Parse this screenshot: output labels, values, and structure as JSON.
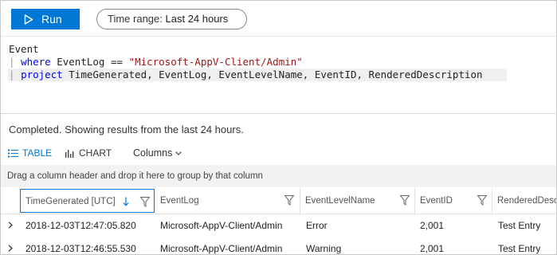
{
  "toolbar": {
    "run_label": "Run",
    "time_range_key": "Time range:",
    "time_range_value": "Last 24 hours"
  },
  "editor": {
    "line1": "Event",
    "line2_pipe": "|",
    "line2_kw": "where",
    "line2_text": " EventLog == ",
    "line2_string": "\"Microsoft-AppV-Client/Admin\"",
    "line3_pipe": "|",
    "line3_kw": "project",
    "line3_text": " TimeGenerated, EventLog, EventLevelName, EventID, RenderedDescription"
  },
  "results": {
    "status": "Completed. Showing results from the last 24 hours.",
    "tabs": {
      "table": "TABLE",
      "chart": "CHART",
      "columns": "Columns"
    },
    "group_hint": "Drag a column header and drop it here to group by that column",
    "columns": [
      "TimeGenerated [UTC]",
      "EventLog",
      "EventLevelName",
      "EventID",
      "RenderedDesc"
    ],
    "rows": [
      [
        "2018-12-03T12:47:05.820",
        "Microsoft-AppV-Client/Admin",
        "Error",
        "2,001",
        "Test Entry"
      ],
      [
        "2018-12-03T12:46:55.530",
        "Microsoft-AppV-Client/Admin",
        "Warning",
        "2,001",
        "Test Entry"
      ]
    ]
  },
  "colors": {
    "accent": "#0078d4",
    "keyword": "#0000ff",
    "string": "#a31515"
  }
}
